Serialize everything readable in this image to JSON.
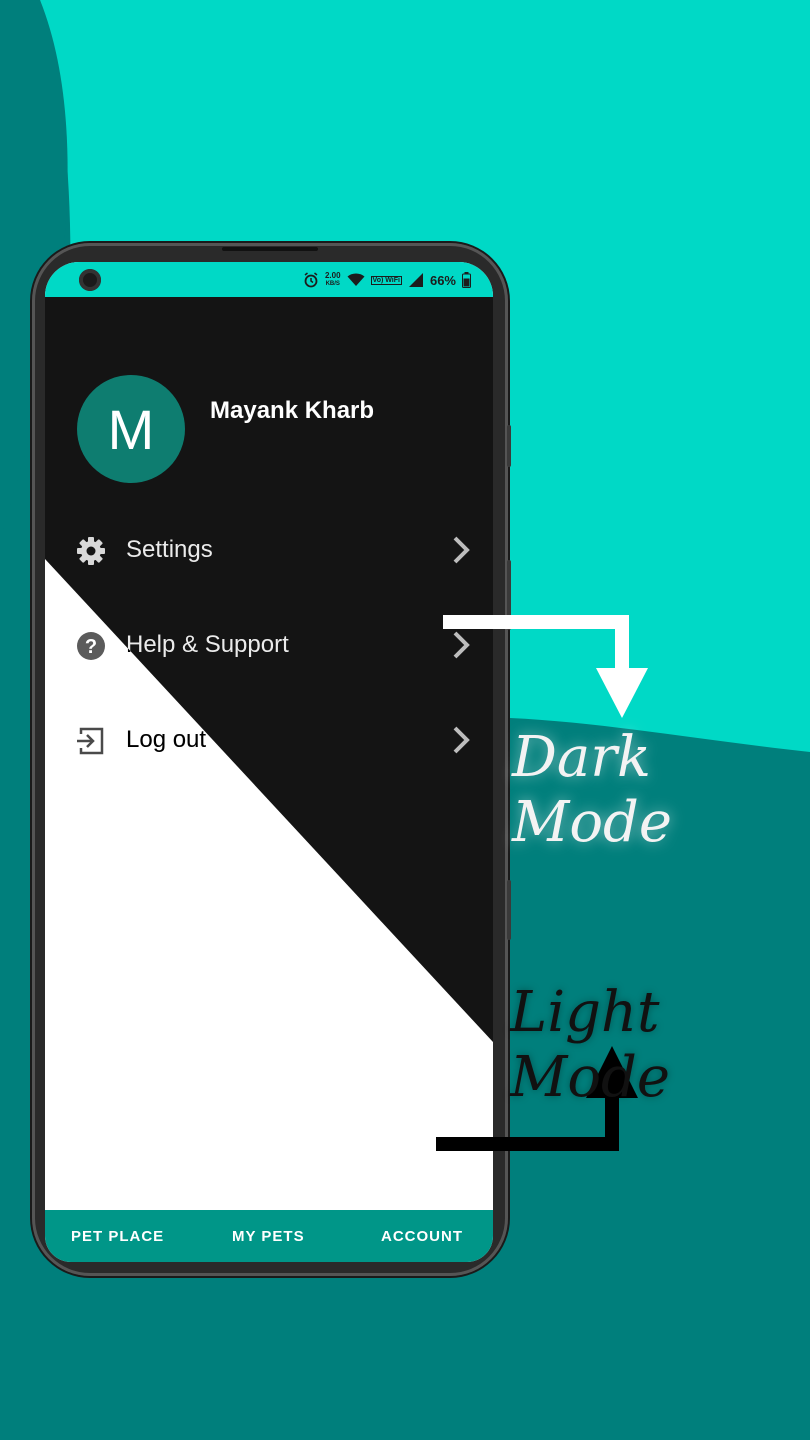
{
  "colors": {
    "background_light": "#00D9C6",
    "background_dark": "#007F7C",
    "status_bar": "#00D9C6",
    "avatar_bg": "#0E7D70",
    "bottom_nav": "#009688",
    "dark_panel": "#141414"
  },
  "status_bar": {
    "net_speed_value": "2.00",
    "net_speed_unit": "KB/S",
    "volte": "Vo) WiFi",
    "battery": "66%"
  },
  "profile": {
    "initial": "M",
    "name": "Mayank Kharb"
  },
  "menu": {
    "items": [
      {
        "label": "Settings",
        "icon": "gear-icon"
      },
      {
        "label": "Help & Support",
        "icon": "help-icon"
      },
      {
        "label": "Log out",
        "icon": "logout-icon"
      }
    ]
  },
  "bottom_nav": {
    "tabs": [
      "PET PLACE",
      "MY PETS",
      "ACCOUNT"
    ]
  },
  "annotations": {
    "dark_mode": "Dark Mode",
    "light_mode": "Light Mode"
  }
}
